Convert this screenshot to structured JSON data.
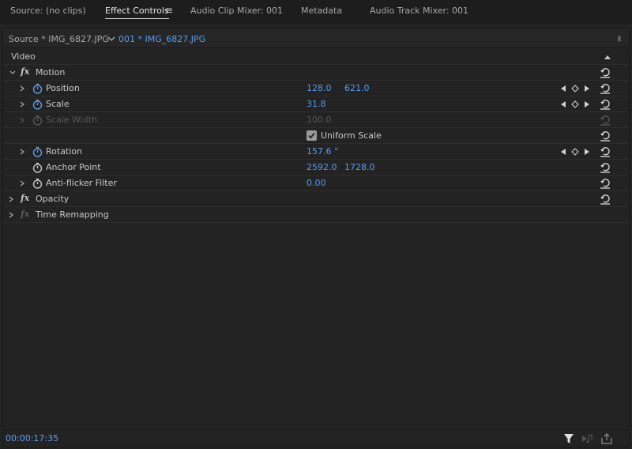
{
  "tabs": [
    {
      "label": "Source: (no clips)"
    },
    {
      "label": "Effect Controls"
    },
    {
      "label": "Audio Clip Mixer: 001"
    },
    {
      "label": "Metadata"
    },
    {
      "label": "Audio Track Mixer: 001"
    }
  ],
  "clip_bar": {
    "source_clip": "Source * IMG_6827.JPG",
    "sequence_clip": "001 * IMG_6827.JPG"
  },
  "section": {
    "label": "Video"
  },
  "effects": {
    "motion": {
      "label": "Motion",
      "fx": "fx"
    },
    "opacity": {
      "label": "Opacity",
      "fx": "fx"
    },
    "time_remapping": {
      "label": "Time Remapping",
      "fx": "fx"
    }
  },
  "properties": {
    "position": {
      "label": "Position",
      "x": "128.0",
      "y": "621.0"
    },
    "scale": {
      "label": "Scale",
      "value": "31.8"
    },
    "scale_width": {
      "label": "Scale Width",
      "value": "100.0"
    },
    "uniform_scale": {
      "label": "Uniform Scale",
      "checked": true
    },
    "rotation": {
      "label": "Rotation",
      "value": "157.6 °"
    },
    "anchor_point": {
      "label": "Anchor Point",
      "x": "2592.0",
      "y": "1728.0"
    },
    "anti_flicker": {
      "label": "Anti-flicker Filter",
      "value": "0.00"
    }
  },
  "status": {
    "timecode": "00:00:17:35"
  },
  "colors": {
    "accent": "#5d9bea",
    "background": "#232323",
    "tabbar": "#1d1d1d"
  },
  "icons": [
    "hamburger-menu-icon",
    "chevron-down-icon",
    "stopwatch-icon",
    "reset-icon",
    "keyframe-prev-icon",
    "keyframe-add-icon",
    "keyframe-next-icon",
    "filter-icon",
    "play-audio-icon",
    "export-icon"
  ]
}
